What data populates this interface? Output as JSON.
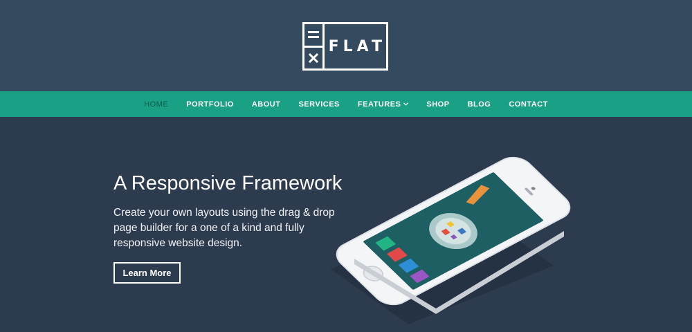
{
  "brand": {
    "word": "FLAT"
  },
  "nav": {
    "items": [
      {
        "label": "HOME",
        "active": true
      },
      {
        "label": "PORTFOLIO"
      },
      {
        "label": "ABOUT"
      },
      {
        "label": "SERVICES"
      },
      {
        "label": "FEATURES",
        "has_dropdown": true
      },
      {
        "label": "SHOP"
      },
      {
        "label": "BLOG"
      },
      {
        "label": "CONTACT"
      }
    ]
  },
  "hero": {
    "title": "A Responsive Framework",
    "description": "Create your own layouts using the drag & drop page builder for a one of a kind and fully responsive website design.",
    "button_label": "Learn More"
  },
  "colors": {
    "header_bg": "#344a5e",
    "nav_bg": "#1aa084",
    "hero_bg": "#2d3b4e",
    "active_nav": "#0f5e4d"
  },
  "icons": [
    "equals-icon",
    "close-icon",
    "chevron-down-icon",
    "phone-app-icon",
    "play-app-icon",
    "chat-app-icon",
    "settings-app-icon"
  ]
}
